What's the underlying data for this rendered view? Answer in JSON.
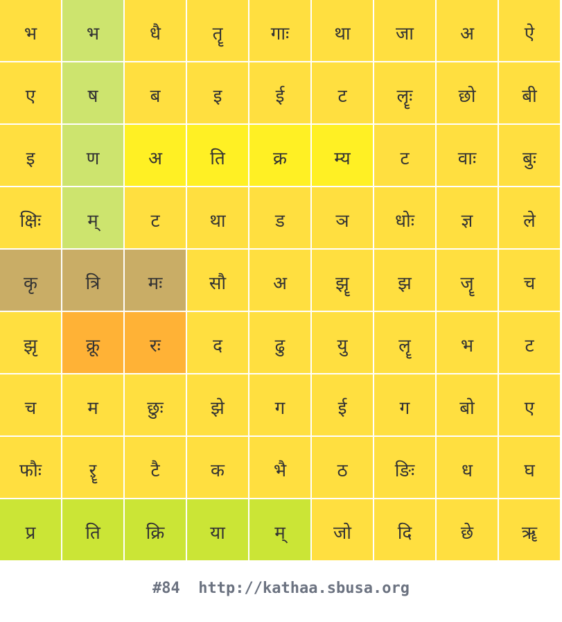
{
  "colors": {
    "default": "#ffdf40",
    "green_column": "#cde46e",
    "bright_yellow": "#fff024",
    "tan": "#c9ad66",
    "orange": "#ffb236",
    "lime_row": "#cbe536",
    "text": "#333333",
    "footer_text": "#6b7280"
  },
  "grid": {
    "rows": [
      [
        {
          "text": "भ",
          "color": "default"
        },
        {
          "text": "भ",
          "color": "green_column"
        },
        {
          "text": "धै",
          "color": "default"
        },
        {
          "text": "तॄ",
          "color": "default"
        },
        {
          "text": "गाः",
          "color": "default"
        },
        {
          "text": "था",
          "color": "default"
        },
        {
          "text": "जा",
          "color": "default"
        },
        {
          "text": "अ",
          "color": "default"
        },
        {
          "text": "ऐ",
          "color": "default"
        }
      ],
      [
        {
          "text": "ए",
          "color": "default"
        },
        {
          "text": "ष",
          "color": "green_column"
        },
        {
          "text": "ब",
          "color": "default"
        },
        {
          "text": "इ",
          "color": "default"
        },
        {
          "text": "ई",
          "color": "default"
        },
        {
          "text": "ट",
          "color": "default"
        },
        {
          "text": "लॄः",
          "color": "default"
        },
        {
          "text": "छो",
          "color": "default"
        },
        {
          "text": "बी",
          "color": "default"
        }
      ],
      [
        {
          "text": "इ",
          "color": "default"
        },
        {
          "text": "ण",
          "color": "green_column"
        },
        {
          "text": "अ",
          "color": "bright_yellow"
        },
        {
          "text": "ति",
          "color": "bright_yellow"
        },
        {
          "text": "क्र",
          "color": "bright_yellow"
        },
        {
          "text": "म्य",
          "color": "bright_yellow"
        },
        {
          "text": "ट",
          "color": "default"
        },
        {
          "text": "वाः",
          "color": "default"
        },
        {
          "text": "बुः",
          "color": "default"
        }
      ],
      [
        {
          "text": "क्षिः",
          "color": "default"
        },
        {
          "text": "म्",
          "color": "green_column"
        },
        {
          "text": "ट",
          "color": "default"
        },
        {
          "text": "था",
          "color": "default"
        },
        {
          "text": "ड",
          "color": "default"
        },
        {
          "text": "ञ",
          "color": "default"
        },
        {
          "text": "धोः",
          "color": "default"
        },
        {
          "text": "ज्ञ",
          "color": "default"
        },
        {
          "text": "ले",
          "color": "default"
        }
      ],
      [
        {
          "text": "कृ",
          "color": "tan"
        },
        {
          "text": "त्रि",
          "color": "tan"
        },
        {
          "text": "मः",
          "color": "tan"
        },
        {
          "text": "सौ",
          "color": "default"
        },
        {
          "text": "अ",
          "color": "default"
        },
        {
          "text": "झॄ",
          "color": "default"
        },
        {
          "text": "झ",
          "color": "default"
        },
        {
          "text": "जॄ",
          "color": "default"
        },
        {
          "text": "च",
          "color": "default"
        }
      ],
      [
        {
          "text": "झृ",
          "color": "default"
        },
        {
          "text": "क्रू",
          "color": "orange"
        },
        {
          "text": "रः",
          "color": "orange"
        },
        {
          "text": "द",
          "color": "default"
        },
        {
          "text": "ढु",
          "color": "default"
        },
        {
          "text": "यु",
          "color": "default"
        },
        {
          "text": "लॄ",
          "color": "default"
        },
        {
          "text": "भ",
          "color": "default"
        },
        {
          "text": "ट",
          "color": "default"
        }
      ],
      [
        {
          "text": "च",
          "color": "default"
        },
        {
          "text": "म",
          "color": "default"
        },
        {
          "text": "छुः",
          "color": "default"
        },
        {
          "text": "झे",
          "color": "default"
        },
        {
          "text": "ग",
          "color": "default"
        },
        {
          "text": "ई",
          "color": "default"
        },
        {
          "text": "ग",
          "color": "default"
        },
        {
          "text": "बो",
          "color": "default"
        },
        {
          "text": "ए",
          "color": "default"
        }
      ],
      [
        {
          "text": "फौः",
          "color": "default"
        },
        {
          "text": "ऱॄ",
          "color": "default"
        },
        {
          "text": "टै",
          "color": "default"
        },
        {
          "text": "क",
          "color": "default"
        },
        {
          "text": "भै",
          "color": "default"
        },
        {
          "text": "ठ",
          "color": "default"
        },
        {
          "text": "ङिः",
          "color": "default"
        },
        {
          "text": "ध",
          "color": "default"
        },
        {
          "text": "घ",
          "color": "default"
        }
      ],
      [
        {
          "text": "प्र",
          "color": "lime_row"
        },
        {
          "text": "ति",
          "color": "lime_row"
        },
        {
          "text": "क्रि",
          "color": "lime_row"
        },
        {
          "text": "या",
          "color": "lime_row"
        },
        {
          "text": "म्",
          "color": "lime_row"
        },
        {
          "text": "जो",
          "color": "default"
        },
        {
          "text": "दि",
          "color": "default"
        },
        {
          "text": "छे",
          "color": "default"
        },
        {
          "text": "ॠ",
          "color": "default"
        }
      ]
    ]
  },
  "footer": {
    "puzzle_number": "#84",
    "url": "http://kathaa.sbusa.org"
  }
}
